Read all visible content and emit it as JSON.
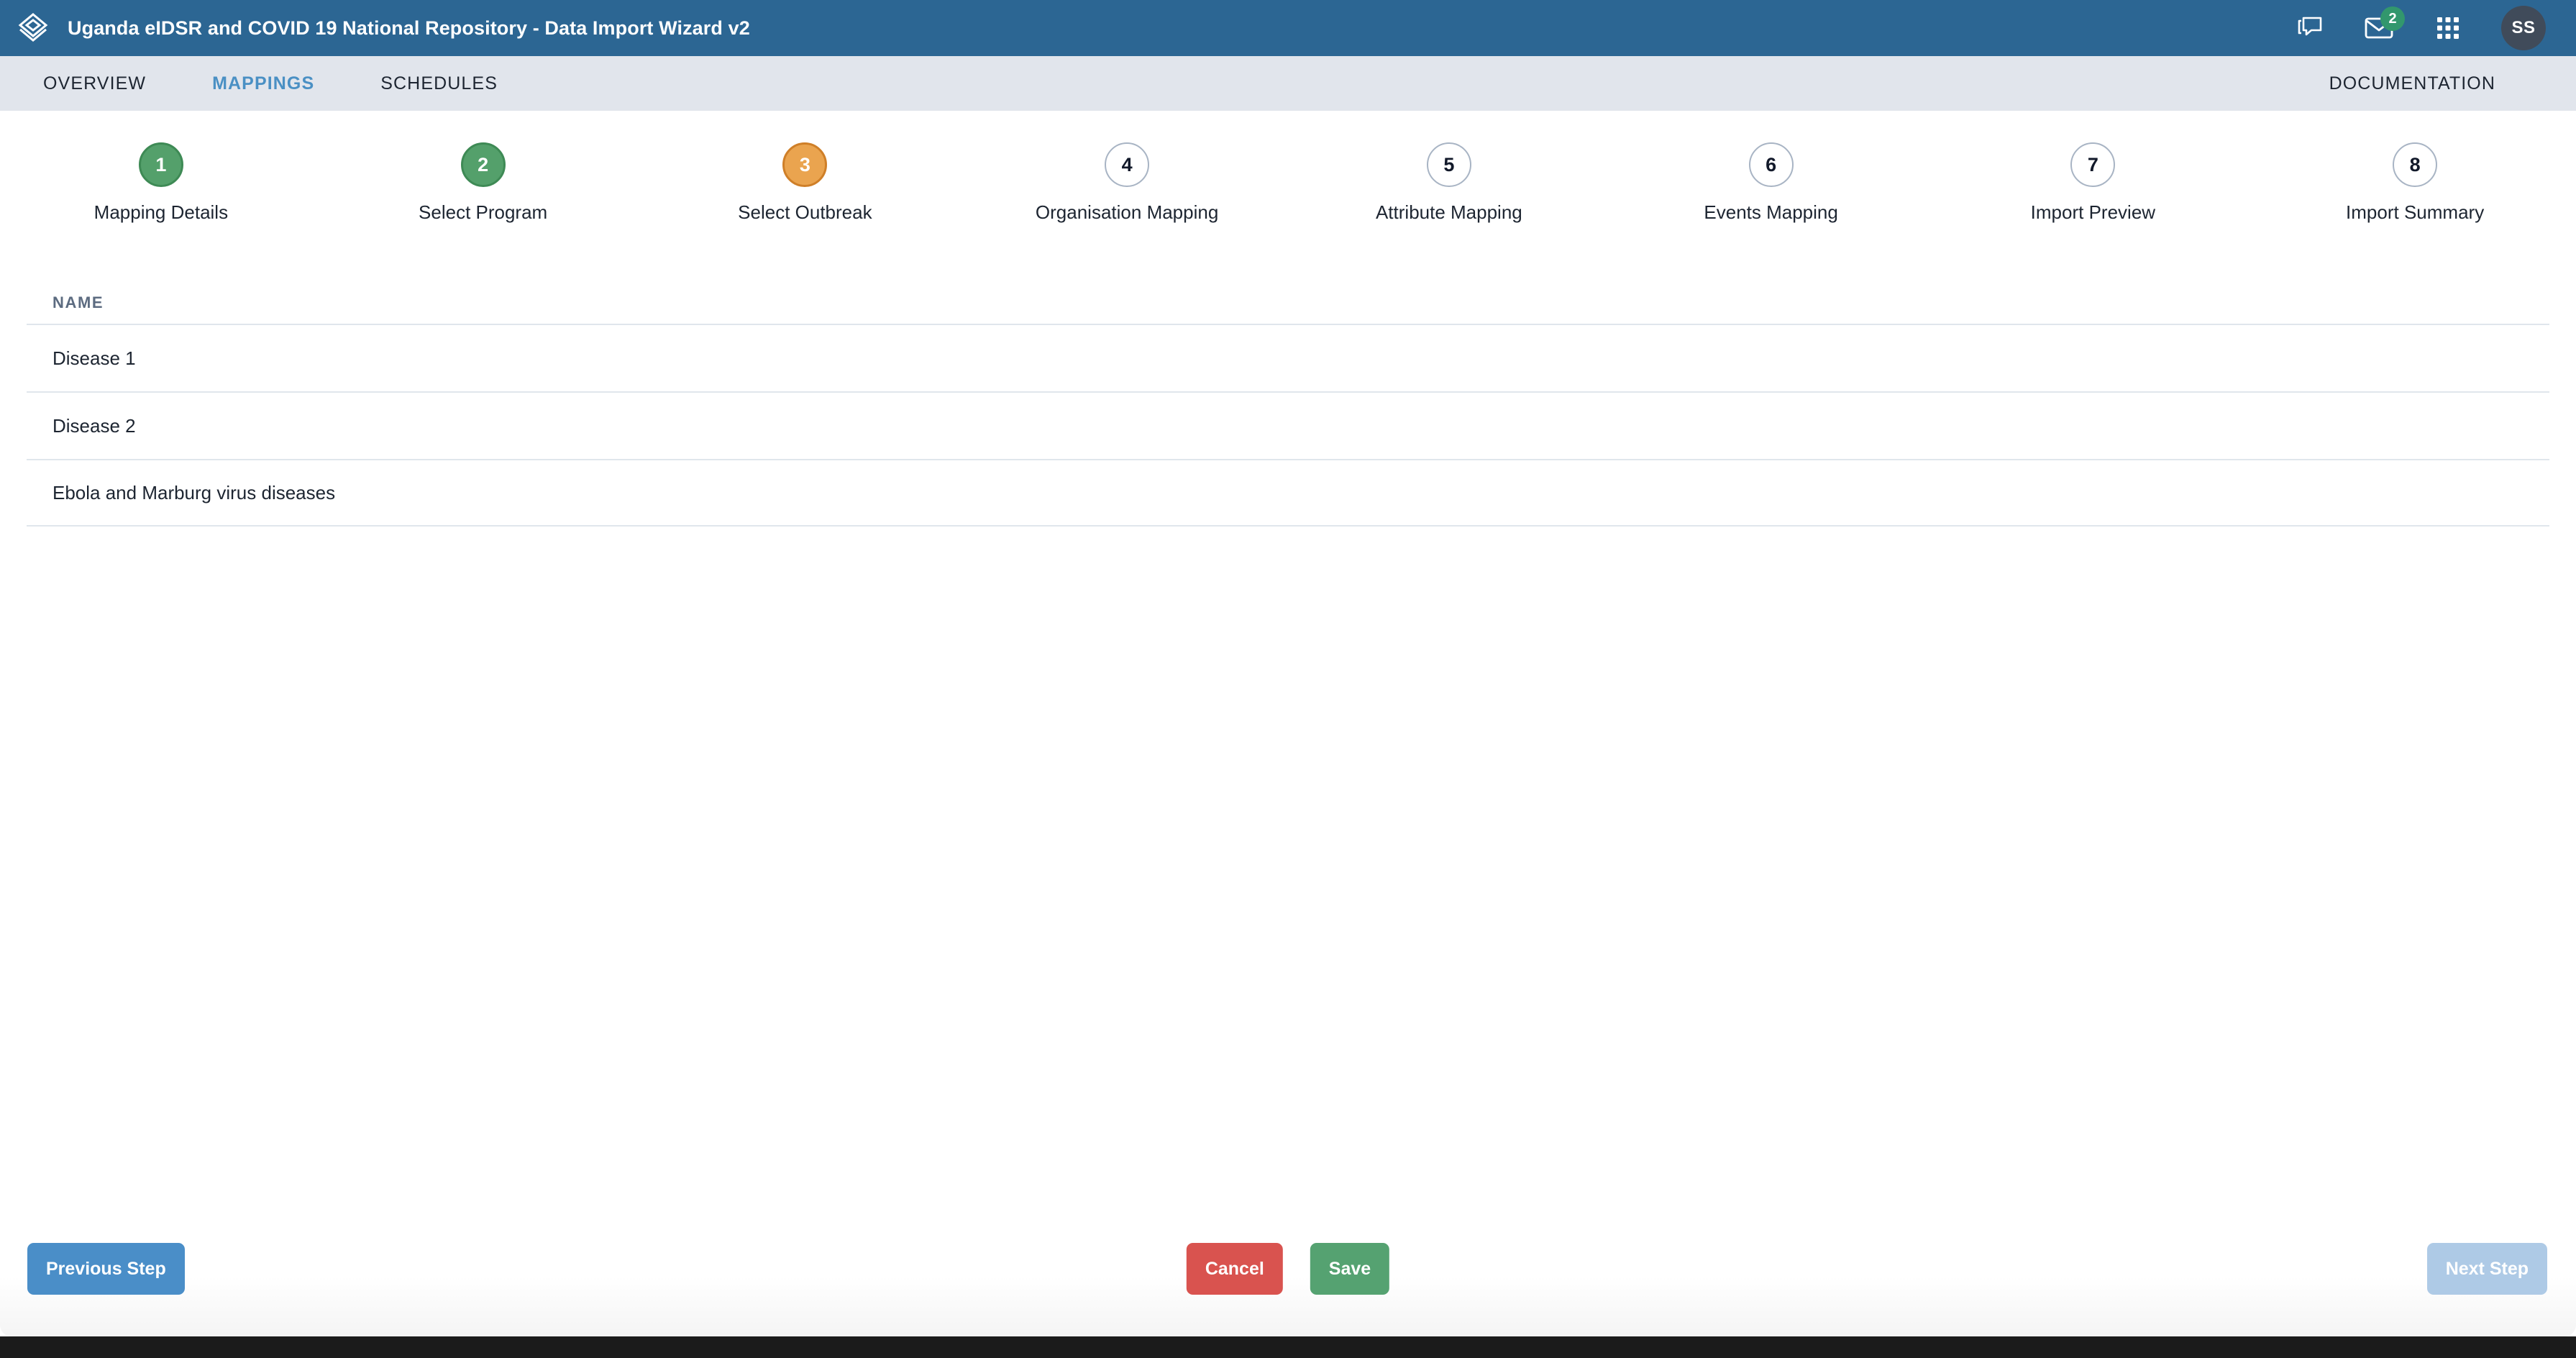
{
  "header": {
    "logo_icon": "layers-icon",
    "title": "Uganda eIDSR and COVID 19 National Repository - Data Import Wizard v2",
    "actions": [
      {
        "icon": "messages-icon",
        "name": "messages"
      },
      {
        "icon": "mail-icon",
        "name": "mail",
        "badge": "2"
      },
      {
        "icon": "apps-grid-icon",
        "name": "apps"
      }
    ],
    "avatar_initials": "SS",
    "colors": {
      "header_bg": "#2c6693",
      "badge_bg": "#32976d",
      "avatar_bg": "#404b5a"
    }
  },
  "tabs": {
    "items": [
      {
        "label": "OVERVIEW",
        "active": false
      },
      {
        "label": "MAPPINGS",
        "active": true
      },
      {
        "label": "SCHEDULES",
        "active": false
      }
    ],
    "documentation_label": "DOCUMENTATION",
    "active_color": "#4a90c4",
    "bar_bg": "#e1e5ec"
  },
  "stepper": {
    "steps": [
      {
        "number": "1",
        "label": "Mapping Details",
        "state": "done"
      },
      {
        "number": "2",
        "label": "Select Program",
        "state": "done"
      },
      {
        "number": "3",
        "label": "Select Outbreak",
        "state": "current"
      },
      {
        "number": "4",
        "label": "Organisation Mapping",
        "state": "pending"
      },
      {
        "number": "5",
        "label": "Attribute Mapping",
        "state": "pending"
      },
      {
        "number": "6",
        "label": "Events Mapping",
        "state": "pending"
      },
      {
        "number": "7",
        "label": "Import Preview",
        "state": "pending"
      },
      {
        "number": "8",
        "label": "Import Summary",
        "state": "pending"
      }
    ],
    "colors": {
      "done_bg": "#54a06b",
      "done_border": "#3e8a55",
      "current_bg": "#eaa44f",
      "current_border": "#cf7f28",
      "pending_border": "#a8b4c4"
    }
  },
  "table": {
    "columns": [
      "NAME"
    ],
    "rows": [
      {
        "name": "Disease 1"
      },
      {
        "name": "Disease 2"
      },
      {
        "name": "Ebola and Marburg virus diseases"
      }
    ]
  },
  "footer": {
    "previous_label": "Previous Step",
    "cancel_label": "Cancel",
    "save_label": "Save",
    "next_label": "Next Step",
    "next_disabled": true,
    "colors": {
      "previous_bg": "#4a8ec8",
      "cancel_bg": "#d9534f",
      "save_bg": "#55a271",
      "next_bg": "#aecae6"
    }
  }
}
